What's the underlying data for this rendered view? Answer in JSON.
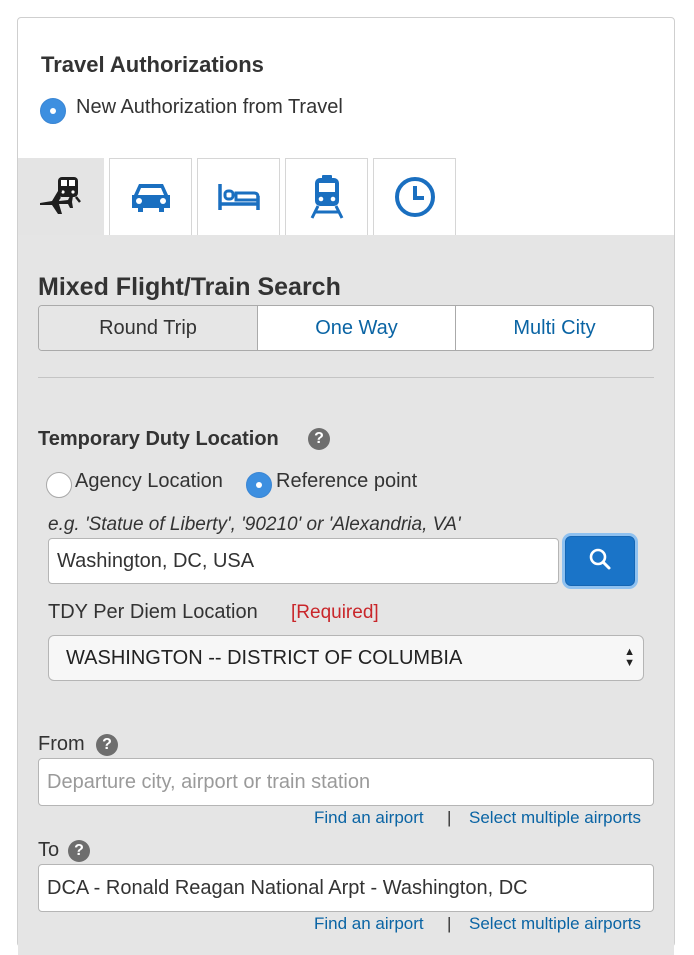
{
  "auth": {
    "title": "Travel Authorizations",
    "option_label": "New Authorization from Travel"
  },
  "tabs": [
    {
      "icon": "flight-train-icon",
      "active": true
    },
    {
      "icon": "car-icon",
      "active": false
    },
    {
      "icon": "hotel-bed-icon",
      "active": false
    },
    {
      "icon": "train-icon",
      "active": false
    },
    {
      "icon": "clock-icon",
      "active": false
    }
  ],
  "search": {
    "title": "Mixed Flight/Train Search",
    "trip_types": [
      "Round Trip",
      "One Way",
      "Multi City"
    ],
    "selected_trip_type": "Round Trip"
  },
  "tdy": {
    "label": "Temporary Duty Location",
    "help": "?",
    "options": [
      "Agency Location",
      "Reference point"
    ],
    "selected_option": "Reference point",
    "example": "e.g. 'Statue of Liberty', '90210' or 'Alexandria, VA'",
    "location_value": "Washington, DC, USA",
    "per_diem_label": "TDY Per Diem Location",
    "required_text": "[Required]",
    "per_diem_value": "WASHINGTON -- DISTRICT OF COLUMBIA"
  },
  "from": {
    "label": "From",
    "help": "?",
    "placeholder": "Departure city, airport or train station",
    "value": "",
    "find_link": "Find an airport",
    "separator": "|",
    "multi_link": "Select multiple airports"
  },
  "to": {
    "label": "To",
    "help": "?",
    "value": "DCA - Ronald Reagan National Arpt - Washington, DC",
    "find_link": "Find an airport",
    "separator": "|",
    "multi_link": "Select multiple airports"
  },
  "colors": {
    "accent": "#3d8fe0",
    "link": "#0a64a4",
    "required": "#c9262a",
    "search_button": "#1a74c8",
    "panel_gray": "#e5e5e5"
  }
}
